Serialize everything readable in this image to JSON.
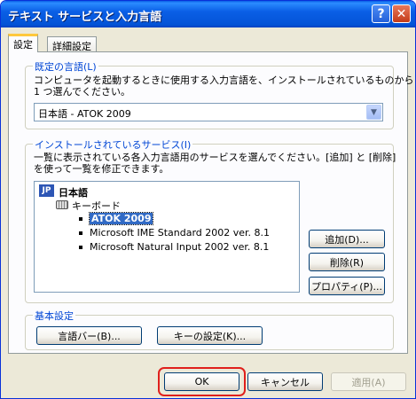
{
  "window": {
    "title": "テキスト サービスと入力言語",
    "help_glyph": "?",
    "close_glyph": "✕"
  },
  "tabs": [
    {
      "label": "設定",
      "active": true
    },
    {
      "label": "詳細設定",
      "active": false
    }
  ],
  "default_language": {
    "legend": "既定の言語(L)",
    "desc1": "コンピュータを起動するときに使用する入力言語を、インストールされているものから",
    "desc2": "1 つ選んでください。",
    "selected_value": "日本語 - ATOK 2009"
  },
  "installed_services": {
    "legend": "インストールされているサービス(I)",
    "desc1": "一覧に表示されている各入力言語用のサービスを選んでください。[追加] と [削除]",
    "desc2": "を使って一覧を修正できます。",
    "language_badge": "JP",
    "language_label": "日本語",
    "category_label": "キーボード",
    "services": [
      {
        "label": "ATOK 2009",
        "selected": true
      },
      {
        "label": "Microsoft IME Standard 2002 ver. 8.1",
        "selected": false
      },
      {
        "label": "Microsoft Natural Input 2002 ver. 8.1",
        "selected": false
      }
    ],
    "add_label": "追加(D)...",
    "remove_label": "削除(R)",
    "properties_label": "プロパティ(P)..."
  },
  "basic_settings": {
    "legend": "基本設定",
    "language_bar_label": "言語バー(B)...",
    "key_settings_label": "キーの設定(K)..."
  },
  "footer": {
    "ok_label": "OK",
    "cancel_label": "キャンセル",
    "apply_label": "適用(A)"
  },
  "colors": {
    "title_bar": "#0a5fe6",
    "group_legend": "#0046d5",
    "selection": "#316ac5",
    "ok_highlight": "#e0201c"
  }
}
